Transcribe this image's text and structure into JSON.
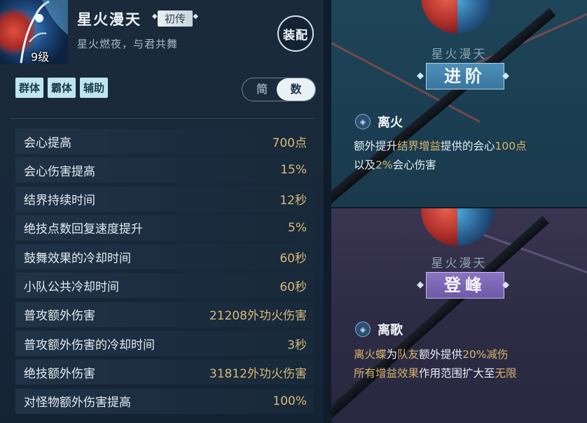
{
  "header": {
    "title": "星火漫天",
    "rank": "初传",
    "subtitle": "星火燃夜，与君共舞",
    "level": "9级",
    "equip_label": "装配"
  },
  "tags": [
    "群体",
    "霸体",
    "辅助"
  ],
  "mode_toggle": {
    "simple": "简",
    "numeric": "数",
    "selected": "数"
  },
  "stats": [
    {
      "label": "会心提高",
      "value": "700点"
    },
    {
      "label": "会心伤害提高",
      "value": "15%"
    },
    {
      "label": "结界持续时间",
      "value": "12秒"
    },
    {
      "label": "绝技点数回复速度提升",
      "value": "5%"
    },
    {
      "label": "鼓舞效果的冷却时间",
      "value": "60秒"
    },
    {
      "label": "小队公共冷却时间",
      "value": "60秒"
    },
    {
      "label": "普攻额外伤害",
      "value": "21208外功火伤害"
    },
    {
      "label": "普攻额外伤害的冷却时间",
      "value": "3秒"
    },
    {
      "label": "绝技额外伤害",
      "value": "31812外功火伤害"
    },
    {
      "label": "对怪物额外伤害提高",
      "value": "100%"
    }
  ],
  "advance_panel": {
    "char_name": "星火漫天",
    "stage": "进阶",
    "skill_name": "离火",
    "desc": {
      "p1": "额外提升",
      "h1": "结界增益",
      "p2": "提供的会心",
      "h2": "100点",
      "p3": "以及",
      "h3": "2%",
      "p4": "会心伤害"
    }
  },
  "peak_panel": {
    "char_name": "星火漫天",
    "stage": "登峰",
    "skill_name": "离歌",
    "desc": {
      "h1": "离火蝶",
      "p1": "为",
      "h2": "队友",
      "p2": "额外提供",
      "h3": "20%减伤",
      "h4": "所有增益效果",
      "p3": "作用范围扩大至",
      "h5": "无限"
    }
  },
  "colors": {
    "highlight": "#d8b56a",
    "value": "#d8b97a",
    "tag_bg": "#bfe6f0",
    "advance_badge": "#4d8fb8",
    "peak_badge": "#8a73c4"
  }
}
